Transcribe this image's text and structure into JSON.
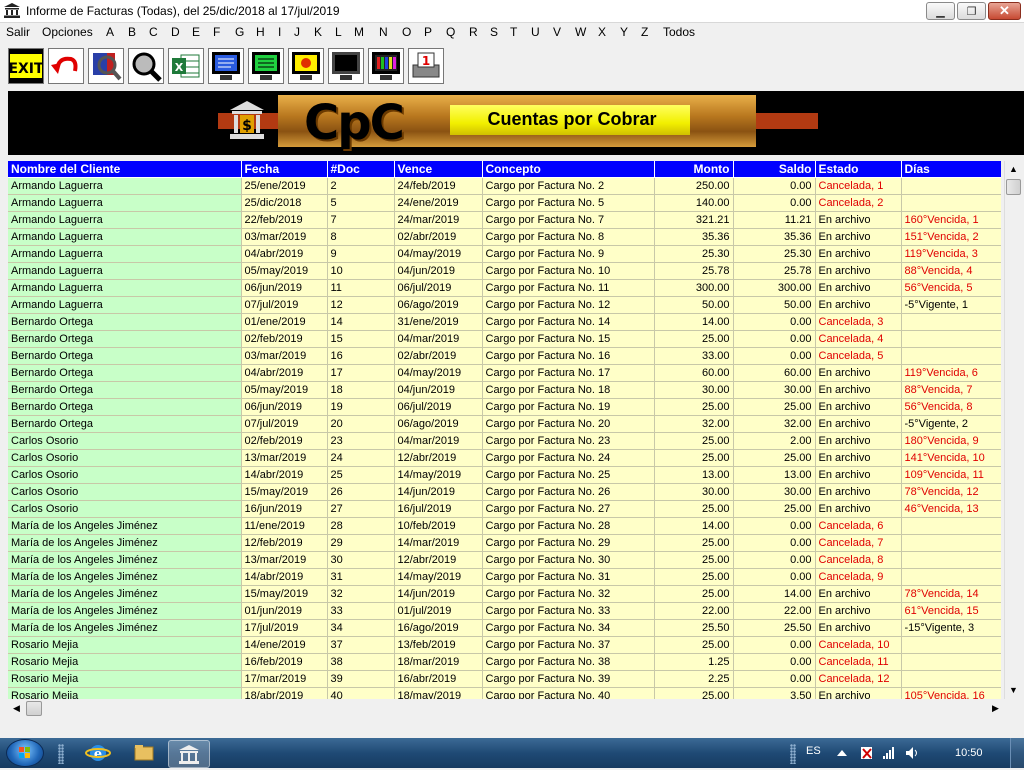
{
  "window": {
    "title": "Informe de Facturas (Todas), del 25/dic/2018 al 17/jul/2019",
    "minimize_glyph": "▁",
    "maximize_glyph": "❐",
    "close_glyph": "✕"
  },
  "menu": [
    "Salir",
    "Opciones",
    "A",
    "B",
    "C",
    "D",
    "E",
    "F",
    "G",
    "H",
    "I",
    "J",
    "K",
    "L",
    "M",
    "N",
    "O",
    "P",
    "Q",
    "R",
    "S",
    "T",
    "U",
    "V",
    "W",
    "X",
    "Y",
    "Z",
    "Todos"
  ],
  "toolbar": [
    {
      "name": "exit-icon",
      "label": "EXIT"
    },
    {
      "name": "undo-icon"
    },
    {
      "name": "search-person-icon"
    },
    {
      "name": "magnifier-icon"
    },
    {
      "name": "excel-icon"
    },
    {
      "name": "monitor-blue-icon"
    },
    {
      "name": "monitor-green-icon"
    },
    {
      "name": "monitor-sun-icon"
    },
    {
      "name": "monitor-black-icon"
    },
    {
      "name": "monitor-chart-icon"
    },
    {
      "name": "printer-icon",
      "label": "1"
    }
  ],
  "banner": {
    "logo": "CpC",
    "label": "Cuentas por Cobrar"
  },
  "table": {
    "headers": [
      "Nombre del Cliente",
      "Fecha",
      "#Doc",
      "Vence",
      "Concepto",
      "Monto",
      "Saldo",
      "Estado",
      "Días"
    ],
    "rows": [
      [
        "Armando Laguerra",
        "25/ene/2019",
        "2",
        "24/feb/2019",
        "Cargo por Factura No. 2",
        "250.00",
        "0.00",
        "Cancelada, 1",
        ""
      ],
      [
        "Armando Laguerra",
        "25/dic/2018",
        "5",
        "24/ene/2019",
        "Cargo por Factura No. 5",
        "140.00",
        "0.00",
        "Cancelada, 2",
        ""
      ],
      [
        "Armando Laguerra",
        "22/feb/2019",
        "7",
        "24/mar/2019",
        "Cargo por Factura No. 7",
        "321.21",
        "11.21",
        "En archivo",
        "160°Vencida, 1"
      ],
      [
        "Armando Laguerra",
        "03/mar/2019",
        "8",
        "02/abr/2019",
        "Cargo por Factura No. 8",
        "35.36",
        "35.36",
        "En archivo",
        "151°Vencida, 2"
      ],
      [
        "Armando Laguerra",
        "04/abr/2019",
        "9",
        "04/may/2019",
        "Cargo por Factura No. 9",
        "25.30",
        "25.30",
        "En archivo",
        "119°Vencida, 3"
      ],
      [
        "Armando Laguerra",
        "05/may/2019",
        "10",
        "04/jun/2019",
        "Cargo por Factura No. 10",
        "25.78",
        "25.78",
        "En archivo",
        "88°Vencida, 4"
      ],
      [
        "Armando Laguerra",
        "06/jun/2019",
        "11",
        "06/jul/2019",
        "Cargo por Factura No. 11",
        "300.00",
        "300.00",
        "En archivo",
        "56°Vencida, 5"
      ],
      [
        "Armando Laguerra",
        "07/jul/2019",
        "12",
        "06/ago/2019",
        "Cargo por Factura No. 12",
        "50.00",
        "50.00",
        "En archivo",
        "-5°Vigente, 1"
      ],
      [
        "Bernardo Ortega",
        "01/ene/2019",
        "14",
        "31/ene/2019",
        "Cargo por Factura No. 14",
        "14.00",
        "0.00",
        "Cancelada, 3",
        ""
      ],
      [
        "Bernardo Ortega",
        "02/feb/2019",
        "15",
        "04/mar/2019",
        "Cargo por Factura No. 15",
        "25.00",
        "0.00",
        "Cancelada, 4",
        ""
      ],
      [
        "Bernardo Ortega",
        "03/mar/2019",
        "16",
        "02/abr/2019",
        "Cargo por Factura No. 16",
        "33.00",
        "0.00",
        "Cancelada, 5",
        ""
      ],
      [
        "Bernardo Ortega",
        "04/abr/2019",
        "17",
        "04/may/2019",
        "Cargo por Factura No. 17",
        "60.00",
        "60.00",
        "En archivo",
        "119°Vencida, 6"
      ],
      [
        "Bernardo Ortega",
        "05/may/2019",
        "18",
        "04/jun/2019",
        "Cargo por Factura No. 18",
        "30.00",
        "30.00",
        "En archivo",
        "88°Vencida, 7"
      ],
      [
        "Bernardo Ortega",
        "06/jun/2019",
        "19",
        "06/jul/2019",
        "Cargo por Factura No. 19",
        "25.00",
        "25.00",
        "En archivo",
        "56°Vencida, 8"
      ],
      [
        "Bernardo Ortega",
        "07/jul/2019",
        "20",
        "06/ago/2019",
        "Cargo por Factura No. 20",
        "32.00",
        "32.00",
        "En archivo",
        "-5°Vigente, 2"
      ],
      [
        "Carlos Osorio",
        "02/feb/2019",
        "23",
        "04/mar/2019",
        "Cargo por Factura No. 23",
        "25.00",
        "2.00",
        "En archivo",
        "180°Vencida, 9"
      ],
      [
        "Carlos Osorio",
        "13/mar/2019",
        "24",
        "12/abr/2019",
        "Cargo por Factura No. 24",
        "25.00",
        "25.00",
        "En archivo",
        "141°Vencida, 10"
      ],
      [
        "Carlos Osorio",
        "14/abr/2019",
        "25",
        "14/may/2019",
        "Cargo por Factura No. 25",
        "13.00",
        "13.00",
        "En archivo",
        "109°Vencida, 11"
      ],
      [
        "Carlos Osorio",
        "15/may/2019",
        "26",
        "14/jun/2019",
        "Cargo por Factura No. 26",
        "30.00",
        "30.00",
        "En archivo",
        "78°Vencida, 12"
      ],
      [
        "Carlos Osorio",
        "16/jun/2019",
        "27",
        "16/jul/2019",
        "Cargo por Factura No. 27",
        "25.00",
        "25.00",
        "En archivo",
        "46°Vencida, 13"
      ],
      [
        "María de los Angeles Jiménez",
        "11/ene/2019",
        "28",
        "10/feb/2019",
        "Cargo por Factura No. 28",
        "14.00",
        "0.00",
        "Cancelada, 6",
        ""
      ],
      [
        "María de los Angeles Jiménez",
        "12/feb/2019",
        "29",
        "14/mar/2019",
        "Cargo por Factura No. 29",
        "25.00",
        "0.00",
        "Cancelada, 7",
        ""
      ],
      [
        "María de los Angeles Jiménez",
        "13/mar/2019",
        "30",
        "12/abr/2019",
        "Cargo por Factura No. 30",
        "25.00",
        "0.00",
        "Cancelada, 8",
        ""
      ],
      [
        "María de los Angeles Jiménez",
        "14/abr/2019",
        "31",
        "14/may/2019",
        "Cargo por Factura No. 31",
        "25.00",
        "0.00",
        "Cancelada, 9",
        ""
      ],
      [
        "María de los Angeles Jiménez",
        "15/may/2019",
        "32",
        "14/jun/2019",
        "Cargo por Factura No. 32",
        "25.00",
        "14.00",
        "En archivo",
        "78°Vencida, 14"
      ],
      [
        "María de los Angeles Jiménez",
        "01/jun/2019",
        "33",
        "01/jul/2019",
        "Cargo por Factura No. 33",
        "22.00",
        "22.00",
        "En archivo",
        "61°Vencida, 15"
      ],
      [
        "María de los Angeles Jiménez",
        "17/jul/2019",
        "34",
        "16/ago/2019",
        "Cargo por Factura No. 34",
        "25.50",
        "25.50",
        "En archivo",
        "-15°Vigente, 3"
      ],
      [
        "Rosario Mejia",
        "14/ene/2019",
        "37",
        "13/feb/2019",
        "Cargo por Factura No. 37",
        "25.00",
        "0.00",
        "Cancelada, 10",
        ""
      ],
      [
        "Rosario Mejia",
        "16/feb/2019",
        "38",
        "18/mar/2019",
        "Cargo por Factura No. 38",
        "1.25",
        "0.00",
        "Cancelada, 11",
        ""
      ],
      [
        "Rosario Mejia",
        "17/mar/2019",
        "39",
        "16/abr/2019",
        "Cargo por Factura No. 39",
        "2.25",
        "0.00",
        "Cancelada, 12",
        ""
      ],
      [
        "Rosario Mejia",
        "18/abr/2019",
        "40",
        "18/may/2019",
        "Cargo por Factura No. 40",
        "25.00",
        "3.50",
        "En archivo",
        "105°Vencida, 16"
      ]
    ]
  },
  "colors": {
    "header_bg": "#0000ff",
    "name_cell_bg": "#c8ffc8",
    "cell_bg": "#ffffc8",
    "status_red": "#e00000"
  },
  "taskbar": {
    "language": "ES",
    "time": "10:50",
    "apps": [
      "internet-explorer-icon",
      "file-explorer-icon",
      "cpc-app-icon"
    ],
    "tray": [
      "show-hidden-icons-icon",
      "action-center-icon",
      "network-icon",
      "volume-icon"
    ]
  }
}
